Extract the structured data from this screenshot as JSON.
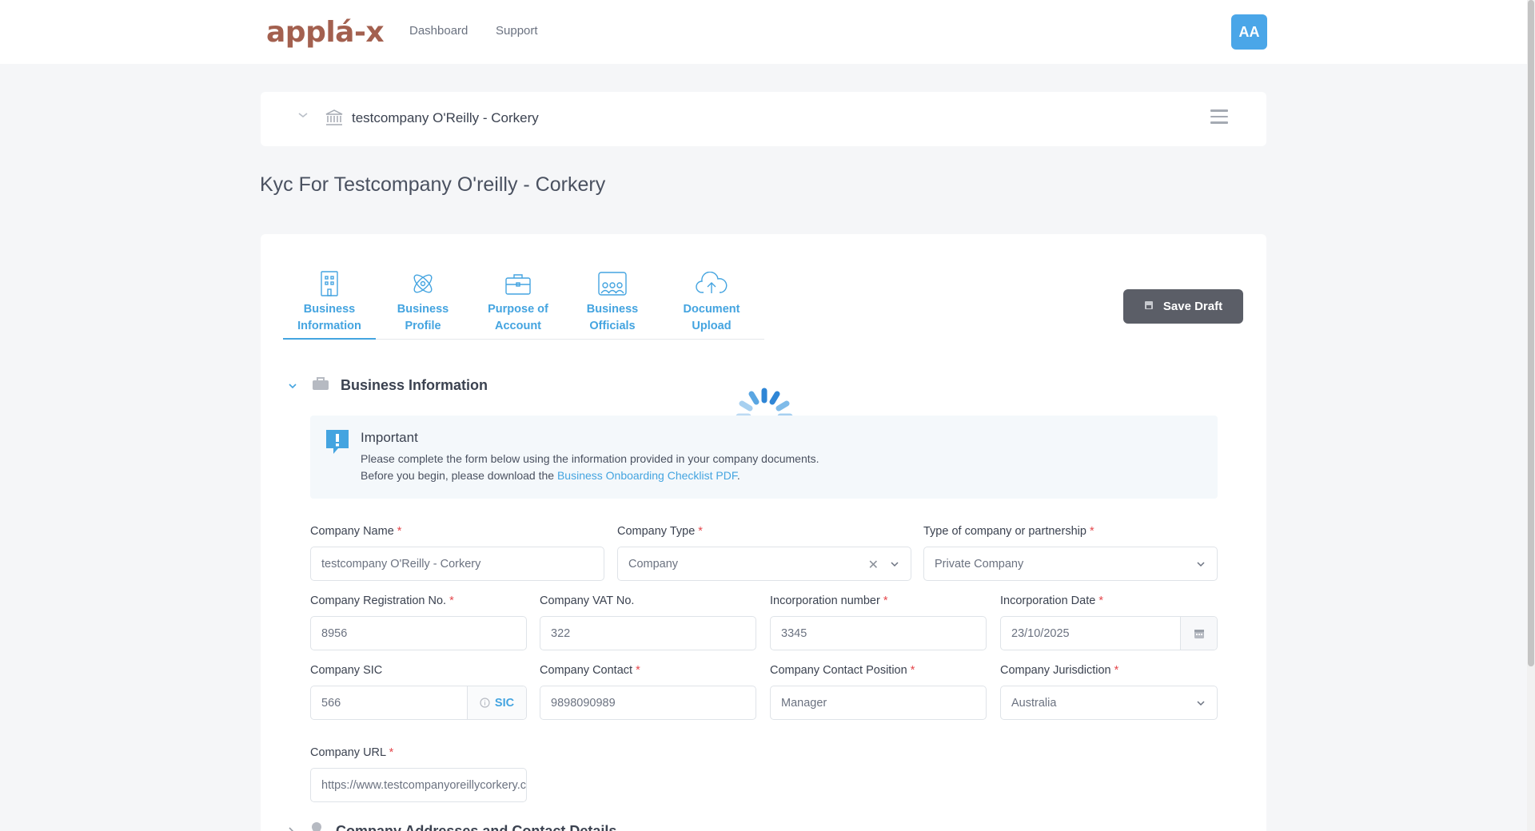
{
  "header": {
    "logo": "applá-x",
    "nav": [
      "Dashboard",
      "Support"
    ],
    "avatar_initials": "AA"
  },
  "company_bar": {
    "name": "testcompany O'Reilly - Corkery"
  },
  "page_title": "Kyc For Testcompany O'reilly - Corkery",
  "tabs": [
    {
      "line1": "Business",
      "line2": "Information",
      "icon": "building-icon",
      "active": true
    },
    {
      "line1": "Business",
      "line2": "Profile",
      "icon": "atom-icon",
      "active": false
    },
    {
      "line1": "Purpose of",
      "line2": "Account",
      "icon": "briefcase-icon",
      "active": false
    },
    {
      "line1": "Business",
      "line2": "Officials",
      "icon": "people-icon",
      "active": false
    },
    {
      "line1": "Document",
      "line2": "Upload",
      "icon": "cloud-upload-icon",
      "active": false
    }
  ],
  "save_draft_label": "Save Draft",
  "section": {
    "title": "Business Information",
    "next_title": "Company Addresses and Contact Details"
  },
  "notice": {
    "title": "Important",
    "line1": "Please complete the form below using the information provided in your company documents.",
    "line2_prefix": "Before you begin, please download the ",
    "line2_link": "Business Onboarding Checklist PDF",
    "line2_suffix": "."
  },
  "form": {
    "company_name": {
      "label": "Company Name",
      "value": "testcompany O'Reilly - Corkery"
    },
    "company_type": {
      "label": "Company Type",
      "value": "Company"
    },
    "partnership_type": {
      "label": "Type of company or partnership",
      "value": "Private Company"
    },
    "registration_no": {
      "label": "Company Registration No.",
      "value": "8956"
    },
    "vat_no": {
      "label": "Company VAT No.",
      "value": "322"
    },
    "incorporation_number": {
      "label": "Incorporation number",
      "value": "3345"
    },
    "incorporation_date": {
      "label": "Incorporation Date",
      "value": "23/10/2025"
    },
    "sic": {
      "label": "Company SIC",
      "value": "566",
      "addon": "SIC"
    },
    "contact": {
      "label": "Company Contact",
      "value": "9898090989"
    },
    "contact_position": {
      "label": "Company Contact Position",
      "value": "Manager"
    },
    "jurisdiction": {
      "label": "Company Jurisdiction",
      "value": "Australia"
    },
    "url": {
      "label": "Company URL",
      "value": "https://www.testcompanyoreillycorkery.com"
    }
  },
  "colors": {
    "accent": "#44a4e0",
    "brand": "#a3604f",
    "button": "#5b5e67",
    "required": "#e5484d"
  }
}
